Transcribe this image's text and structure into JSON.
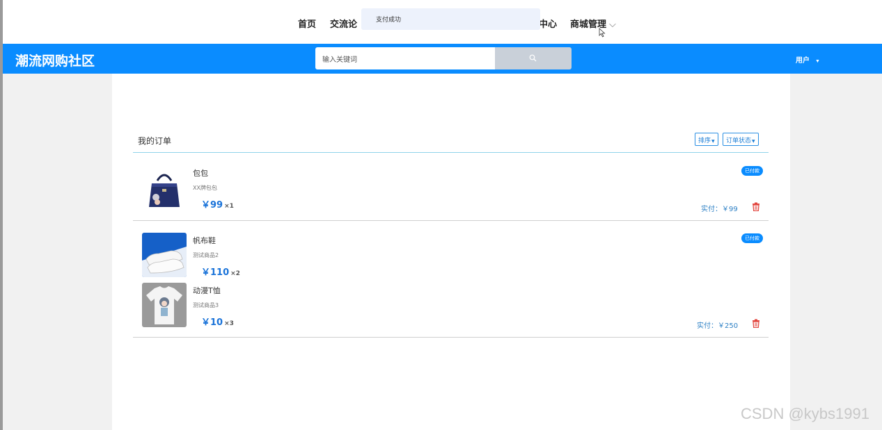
{
  "top_nav": {
    "items": [
      "首页",
      "交流论坛",
      "个人中心",
      "商城管理"
    ],
    "visible_partial": [
      "首页",
      "交流论",
      "中心",
      "商城管理"
    ]
  },
  "toast": {
    "message": "支付成功"
  },
  "header": {
    "site_title": "潮流网购社区",
    "search_placeholder": "输入关键词",
    "user_label": "用户",
    "brand_color": "#0a8cff"
  },
  "orders": {
    "title": "我的订单",
    "sort_label": "排序",
    "status_filter_label": "订单状态",
    "list": [
      {
        "status": "已付款",
        "paid_text": "实付：￥99",
        "items": [
          {
            "name": "包包",
            "desc": "XX牌包包",
            "price": "￥99",
            "qty": "×1",
            "image": "handbag"
          }
        ]
      },
      {
        "status": "已付款",
        "paid_text": "实付：￥250",
        "items": [
          {
            "name": "帆布鞋",
            "desc": "测试商品2",
            "price": "￥110",
            "qty": "×2",
            "image": "sneakers"
          },
          {
            "name": "动漫T恤",
            "desc": "测试商品3",
            "price": "￥10",
            "qty": "×3",
            "image": "tshirt"
          }
        ]
      }
    ]
  },
  "watermark": "CSDN @kybs1991"
}
